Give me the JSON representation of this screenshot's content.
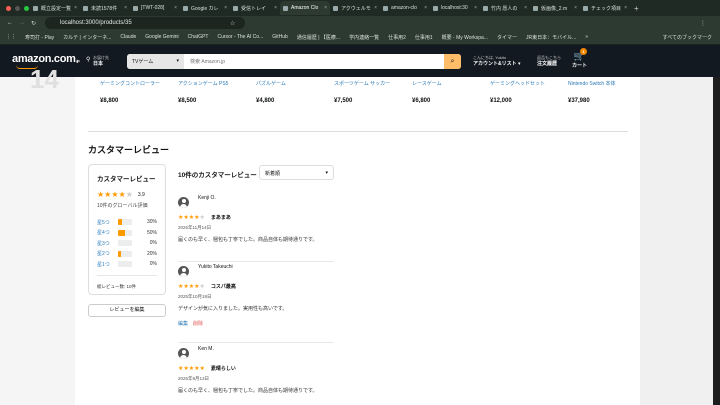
{
  "browser": {
    "tabs": [
      {
        "label": "概立設定一覧"
      },
      {
        "label": "未読1578件"
      },
      {
        "label": "[TWT-028]"
      },
      {
        "label": "Google カレ"
      },
      {
        "label": "受信トレイ"
      },
      {
        "label": "Amazon Clo",
        "active": true
      },
      {
        "label": "アクウェルモ"
      },
      {
        "label": "amazon-clo"
      },
      {
        "label": "localhost:30"
      },
      {
        "label": "竹内 愿人の"
      },
      {
        "label": "仮画像_2.m"
      },
      {
        "label": "チェック項目"
      }
    ],
    "url": "localhost:3000/products/35",
    "bookmarks": [
      "寿司打 - Play",
      "カルテ | インターネ...",
      "Claude",
      "Google Gemini",
      "ChatGPT",
      "Cursor - The AI Co...",
      "GitHub",
      "通信履歴 | 【医療...",
      "学内連絡一覧",
      "仕事用2",
      "仕事用1",
      "概要 - My Workspa...",
      "タイマー",
      "JR東日本：モバイル...",
      "»",
      "すべてのブックマーク"
    ]
  },
  "header": {
    "logo": "amazon.com",
    "logo_suffix": ".jp",
    "deliver_label": "お届け先",
    "deliver_value": "日本",
    "search_category": "TVゲーム",
    "search_placeholder": "検索 Amazon.jp",
    "greeting": "こんにちは, Yukito",
    "account": "アカウント&リスト",
    "returns": "返品もこちら",
    "orders": "注文履歴",
    "cart_label": "カート",
    "cart_count": "1"
  },
  "overlay_number": "14",
  "related_products": [
    {
      "name": "ゲーミングコントローラー",
      "price": "¥8,800"
    },
    {
      "name": "アクションゲーム PS5",
      "price": "¥8,500"
    },
    {
      "name": "パズルゲーム",
      "price": "¥4,800"
    },
    {
      "name": "スポーツゲーム サッカー",
      "price": "¥7,500"
    },
    {
      "name": "レースゲーム",
      "price": "¥6,800"
    },
    {
      "name": "ゲーミングヘッドセット",
      "price": "¥12,000"
    },
    {
      "name": "Nintendo Switch 本体",
      "price": "¥37,980"
    }
  ],
  "reviews_section": {
    "heading": "カスタマーレビュー",
    "summary": {
      "title": "カスタマーレビュー",
      "rating": "3.9",
      "rating_value": 3.9,
      "global_count": "10件のグローバル評価",
      "breakdown": [
        {
          "label": "星5つ",
          "pct": "30%",
          "value": 30
        },
        {
          "label": "星4つ",
          "pct": "50%",
          "value": 50
        },
        {
          "label": "星3つ",
          "pct": "0%",
          "value": 0
        },
        {
          "label": "星2つ",
          "pct": "20%",
          "value": 20
        },
        {
          "label": "星1つ",
          "pct": "0%",
          "value": 0
        }
      ],
      "total": "総レビュー数: 10件"
    },
    "edit_review_button": "レビューを編集",
    "list_title": "10件のカスタマーレビュー",
    "sort_selected": "新着順",
    "reviews": [
      {
        "name": "Kenji O.",
        "rating": 4,
        "title": "まあまあ",
        "date": "2025年11月14日",
        "body": "届くのも早く、梱包も丁寧でした。商品自体も期待通りです。"
      },
      {
        "name": "Yukito Takeuchi",
        "rating": 4,
        "title": "コスパ最高",
        "date": "2025年10月19日",
        "body": "デザインが気に入りました。実用性も高いです。",
        "edit": "編集",
        "delete": "削除"
      },
      {
        "name": "Ken M.",
        "rating": 5,
        "title": "素晴らしい",
        "date": "2025年9月13日",
        "body": "届くのも早く、梱包も丁寧でした。商品自体も期待通りです。"
      }
    ]
  },
  "colors": {
    "amazon_dark": "#131921",
    "accent": "#ff9900",
    "link": "#2a7ab8",
    "delete": "#e05050"
  }
}
